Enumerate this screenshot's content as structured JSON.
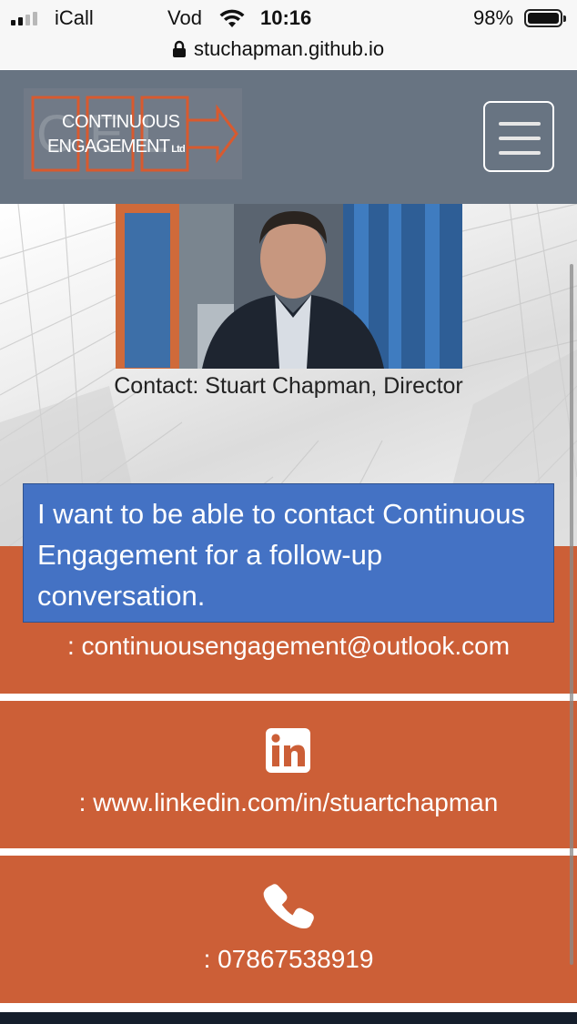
{
  "status_bar": {
    "carrier": "iCall",
    "carrier2": "Vod",
    "time": "10:16",
    "battery_percent": "98%",
    "battery_level": 0.98
  },
  "browser": {
    "url": "stuchapman.github.io"
  },
  "header": {
    "logo_line1": "CONTINUOUS",
    "logo_line2": "ENGAGEMENT",
    "logo_suffix": "Ltd",
    "logo_bg_letters": "C E L",
    "menu_icon": "hamburger-menu-icon"
  },
  "hero": {
    "caption": "Contact: Stuart Chapman, Director"
  },
  "contacts": {
    "email": ": continuousengagement@outlook.com",
    "linkedin": ": www.linkedin.com/in/stuartchapman",
    "phone": ": 07867538919",
    "linkedin_icon": "linkedin-icon",
    "phone_icon": "phone-icon"
  },
  "callout": {
    "text": "I want to be able to contact Continuous Engagement for a follow-up conversation."
  },
  "colors": {
    "header_bg": "#687482",
    "accent_orange": "#cc5f37",
    "callout_blue": "#4472c4",
    "footer_dark": "#151e2b"
  }
}
